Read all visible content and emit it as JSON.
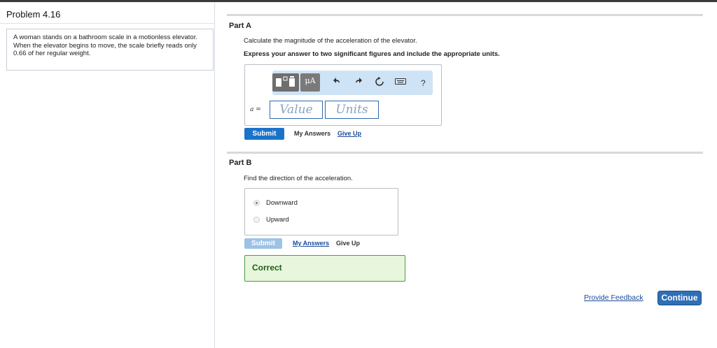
{
  "problem": {
    "title": "Problem 4.16",
    "text": "A woman stands on a bathroom scale in a motionless elevator. When the elevator begins to move, the scale briefly reads only 0.66 of her regular weight."
  },
  "partA": {
    "title": "Part A",
    "question": "Calculate the magnitude of the acceleration of the elevator.",
    "instruction": "Express your answer to two significant figures and include the appropriate units.",
    "toolbar": {
      "templates_icon": "templates-icon",
      "units_label": "μA",
      "undo_icon": "undo-icon",
      "redo_icon": "redo-icon",
      "reset_icon": "reset-icon",
      "keyboard_icon": "keyboard-icon",
      "help_label": "?"
    },
    "variable_label": "a =",
    "value_placeholder": "Value",
    "units_placeholder": "Units",
    "submit_label": "Submit",
    "my_answers_label": "My Answers",
    "give_up_label": "Give Up"
  },
  "partB": {
    "title": "Part B",
    "question": "Find the direction of the acceleration.",
    "options": [
      {
        "label": "Downward",
        "selected": true
      },
      {
        "label": "Upward",
        "selected": false
      }
    ],
    "submit_label": "Submit",
    "my_answers_label": "My Answers",
    "give_up_label": "Give Up",
    "result": "Correct"
  },
  "footer": {
    "feedback_label": "Provide Feedback",
    "continue_label": "Continue"
  },
  "colors": {
    "accent": "#1a73c9",
    "submit_disabled": "#9dc2e6",
    "correct_bg": "#e8f6dd",
    "correct_border": "#4a9d3e",
    "link": "#1a4b9a"
  }
}
